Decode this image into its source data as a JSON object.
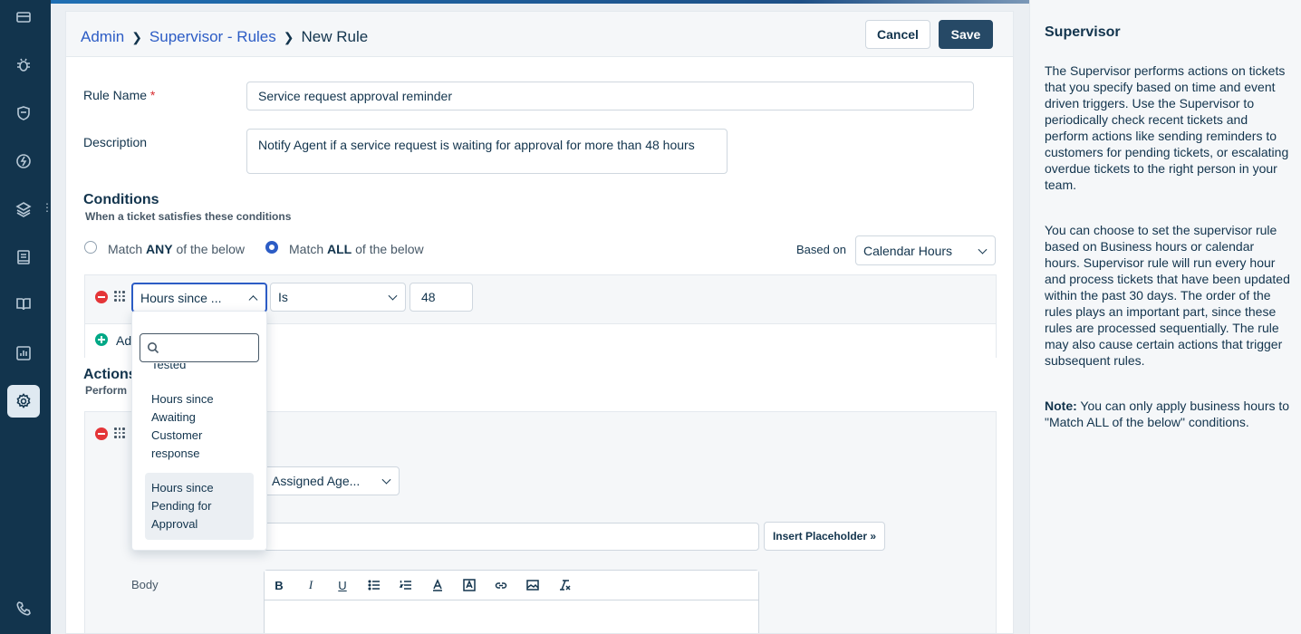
{
  "breadcrumb": {
    "admin": "Admin",
    "rules": "Supervisor - Rules",
    "current": "New Rule"
  },
  "toolbar": {
    "cancel_label": "Cancel",
    "save_label": "Save"
  },
  "form": {
    "rule_name_label": "Rule Name",
    "required_mark": "*",
    "rule_name_value": "Service request approval reminder",
    "description_label": "Description",
    "description_value": "Notify Agent if a service request is waiting for approval for more than 48 hours"
  },
  "conditions": {
    "title": "Conditions",
    "subtitle": "When a ticket satisfies these conditions",
    "match_any_pre": "Match ",
    "match_any_bold": "ANY",
    "match_any_post": " of the below",
    "match_all_pre": "Match ",
    "match_all_bold": "ALL",
    "match_all_post": " of the below",
    "selected_match": "ALL",
    "based_on_label": "Based on",
    "based_on_value": "Calendar Hours",
    "row": {
      "field": "Hours since ...",
      "operator": "Is",
      "value": "48"
    },
    "add_label": "Ad"
  },
  "actions": {
    "title": "Actions",
    "subtitle": "Perform",
    "send_to_value": "Assigned Age...",
    "insert_placeholder_label": "Insert Placeholder »",
    "body_label": "Body"
  },
  "dropdown": {
    "search_placeholder": "",
    "items": [
      {
        "label": "Tested",
        "selected": false
      },
      {
        "label": "Hours since Awaiting Customer response",
        "selected": false
      },
      {
        "label": "Hours since Pending for Approval",
        "selected": true
      }
    ]
  },
  "help_panel": {
    "title": "Supervisor",
    "para1": "The Supervisor performs actions on tickets that you specify based on time and event driven triggers. Use the Supervisor to periodically check recent tickets and perform actions like sending reminders to customers for pending tickets, or escalating overdue tickets to the right person in your team.",
    "para2": "You can choose to set the supervisor rule based on Business hours or calendar hours. Supervisor rule will run every hour and process tickets that have been updated within the past 30 days. The order of the rules plays an important part, since these rules are processed sequentially. The rule may also cause certain actions that trigger subsequent rules.",
    "note_label": "Note:",
    "note_text": " You can only apply business hours to \"Match ALL of the below\" conditions."
  },
  "editor_tools": [
    "B",
    "I",
    "U"
  ],
  "colors": {
    "sidebar": "#12344d",
    "primary": "#264966",
    "link": "#2c5cc5"
  }
}
